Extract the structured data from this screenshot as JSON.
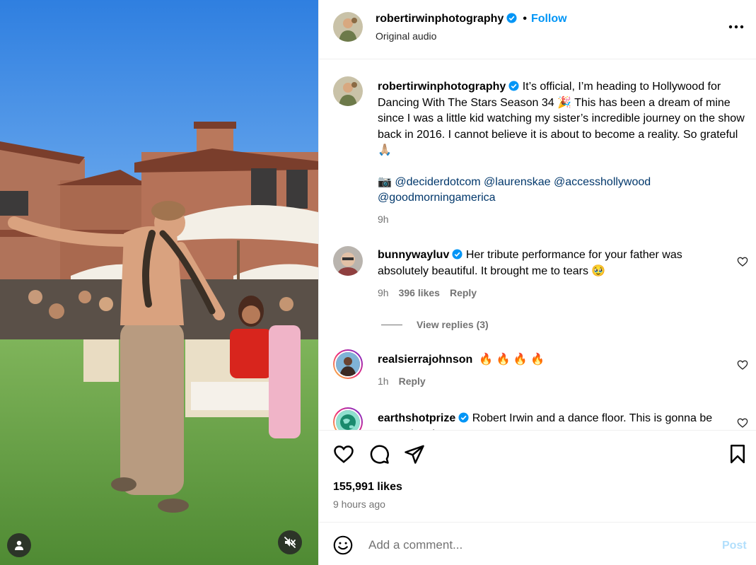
{
  "header": {
    "username": "robertirwinphotography",
    "follow_label": "Follow",
    "dot": "•",
    "audio": "Original audio"
  },
  "caption": {
    "username": "robertirwinphotography",
    "text": "It’s official, I’m heading to Hollywood for Dancing With The Stars Season 34 🎉  This has been a dream of mine since I was a little kid watching my sister’s incredible journey on the show back in 2016. I cannot believe it is about to become a reality. So grateful 🙏🏼",
    "camera": "📷",
    "mentions": [
      "@deciderdotcom",
      "@laurenskae",
      "@accesshollywood",
      "@goodmorningamerica"
    ],
    "time": "9h"
  },
  "comments": [
    {
      "username": "bunnywayluv",
      "text": "Her tribute performance for your father was absolutely beautiful. It brought me to tears 🥹",
      "time": "9h",
      "likes": "396 likes",
      "reply": "Reply"
    },
    {
      "username": "realsierrajohnson",
      "text": "🔥 🔥 🔥 🔥",
      "time": "1h",
      "reply": "Reply"
    },
    {
      "username": "earthshotprize",
      "text": "Robert Irwin and a dance floor. This is gonna be sensational!"
    }
  ],
  "view_replies": "View replies (3)",
  "likes": "155,991 likes",
  "time_ago": "9 hours ago",
  "comment_bar": {
    "placeholder": "Add a comment...",
    "post_label": "Post"
  },
  "colors": {
    "link_blue": "#0095f6",
    "verified_blue": "#0095f6",
    "secondary_text": "#737373",
    "post_disabled": "#b2dffc"
  }
}
